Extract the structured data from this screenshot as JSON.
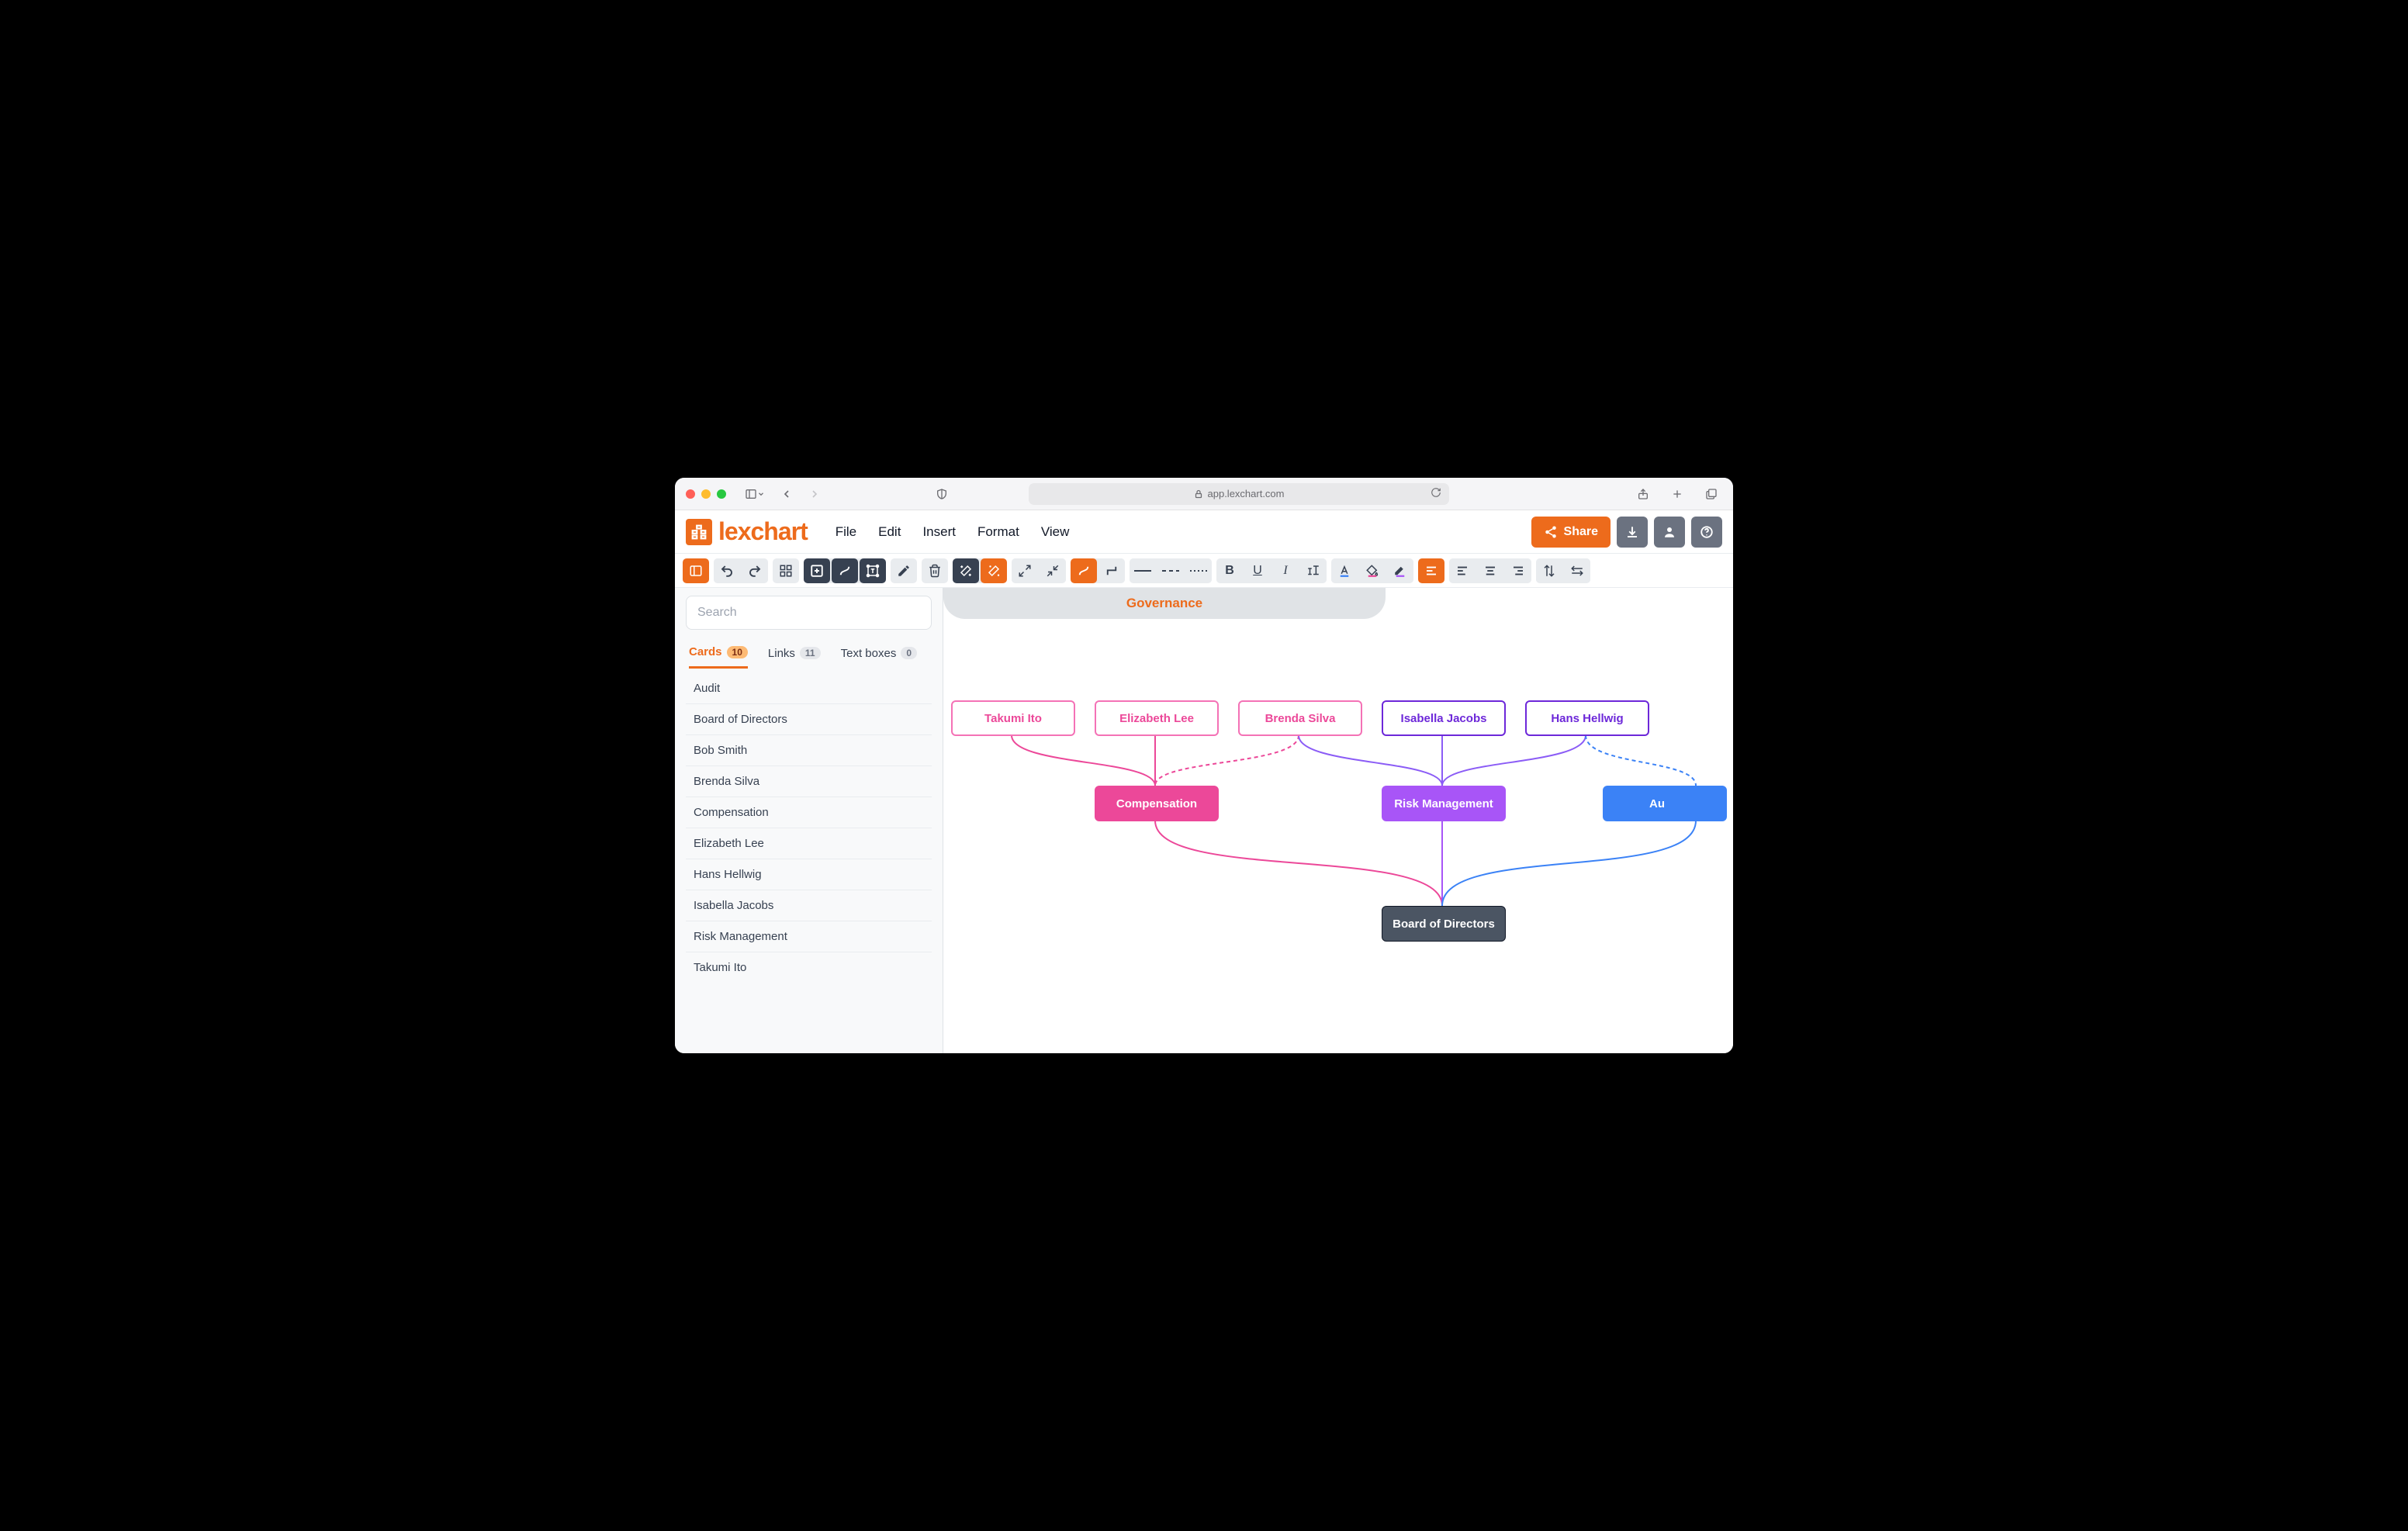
{
  "browser": {
    "url_host": "app.lexchart.com"
  },
  "app": {
    "logo_text": "lexchart",
    "menu": {
      "file": "File",
      "edit": "Edit",
      "insert": "Insert",
      "format": "Format",
      "view": "View"
    },
    "share_label": "Share"
  },
  "sidebar": {
    "search_placeholder": "Search",
    "tabs": {
      "cards": {
        "label": "Cards",
        "count": "10"
      },
      "links": {
        "label": "Links",
        "count": "11"
      },
      "textboxes": {
        "label": "Text boxes",
        "count": "0"
      }
    },
    "cards": [
      "Audit",
      "Board of Directors",
      "Bob Smith",
      "Brenda Silva",
      "Compensation",
      "Elizabeth Lee",
      "Hans Hellwig",
      "Isabella Jacobs",
      "Risk Management",
      "Takumi Ito"
    ]
  },
  "canvas": {
    "title": "Governance",
    "nodes": {
      "takumi": "Takumi Ito",
      "elizabeth": "Elizabeth Lee",
      "brenda": "Brenda Silva",
      "isabella": "Isabella Jacobs",
      "hans": "Hans Hellwig",
      "compensation": "Compensation",
      "risk": "Risk Management",
      "audit": "Au",
      "board": "Board of Directors"
    }
  },
  "chart_data": {
    "type": "hierarchy-diagram",
    "title": "Governance",
    "nodes": [
      {
        "id": "takumi",
        "label": "Takumi Ito",
        "row": 1,
        "style": "outline-pink"
      },
      {
        "id": "elizabeth",
        "label": "Elizabeth Lee",
        "row": 1,
        "style": "outline-pink"
      },
      {
        "id": "brenda",
        "label": "Brenda Silva",
        "row": 1,
        "style": "outline-pink"
      },
      {
        "id": "isabella",
        "label": "Isabella Jacobs",
        "row": 1,
        "style": "outline-purple"
      },
      {
        "id": "hans",
        "label": "Hans Hellwig",
        "row": 1,
        "style": "outline-purple"
      },
      {
        "id": "compensation",
        "label": "Compensation",
        "row": 2,
        "style": "fill-pink"
      },
      {
        "id": "risk",
        "label": "Risk Management",
        "row": 2,
        "style": "fill-purple"
      },
      {
        "id": "audit",
        "label": "Audit",
        "row": 2,
        "style": "fill-blue",
        "clipped": true
      },
      {
        "id": "board",
        "label": "Board of Directors",
        "row": 3,
        "style": "fill-slate"
      }
    ],
    "edges": [
      {
        "from": "takumi",
        "to": "compensation",
        "color": "pink",
        "dashed": false
      },
      {
        "from": "elizabeth",
        "to": "compensation",
        "color": "pink",
        "dashed": false
      },
      {
        "from": "brenda",
        "to": "compensation",
        "color": "pink",
        "dashed": true
      },
      {
        "from": "brenda",
        "to": "risk",
        "color": "purple",
        "dashed": false
      },
      {
        "from": "isabella",
        "to": "risk",
        "color": "purple",
        "dashed": false
      },
      {
        "from": "hans",
        "to": "risk",
        "color": "purple",
        "dashed": false
      },
      {
        "from": "hans",
        "to": "audit",
        "color": "blue",
        "dashed": true
      },
      {
        "from": "compensation",
        "to": "board",
        "color": "pink",
        "dashed": false
      },
      {
        "from": "risk",
        "to": "board",
        "color": "purple",
        "dashed": false
      },
      {
        "from": "audit",
        "to": "board",
        "color": "blue",
        "dashed": false
      }
    ]
  }
}
